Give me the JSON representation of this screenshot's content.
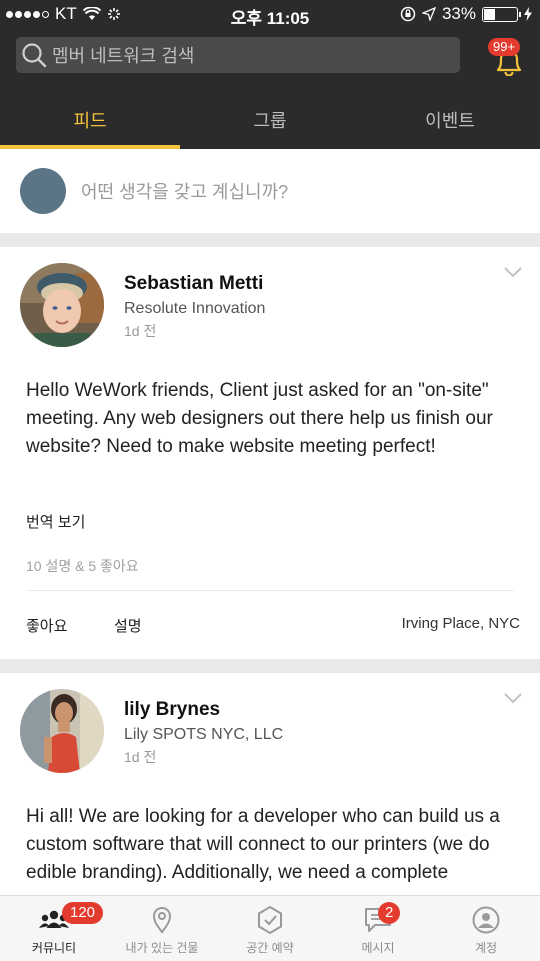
{
  "status": {
    "carrier": "KT",
    "time": "오후 11:05",
    "battery": "33%"
  },
  "header": {
    "search_placeholder": "멤버 네트워크 검색",
    "notif_badge": "99+",
    "tabs": [
      {
        "label": "피드",
        "active": true
      },
      {
        "label": "그룹",
        "active": false
      },
      {
        "label": "이벤트",
        "active": false
      }
    ]
  },
  "composer": {
    "placeholder": "어떤 생각을 갖고 계십니까?"
  },
  "posts": [
    {
      "name": "Sebastian Metti",
      "company": "Resolute Innovation",
      "time": "1d 전",
      "text": "Hello WeWork friends, Client just asked for an \"on-site\" meeting. Any web designers out there help us finish our website? Need to make website meeting perfect!",
      "translate": "번역 보기",
      "stats": "10 설명 & 5 좋아요",
      "like": "좋아요",
      "comment": "설명",
      "location": "Irving Place, NYC"
    },
    {
      "name": "lily Brynes",
      "company": "Lily SPOTS NYC, LLC",
      "time": "1d 전",
      "text": "Hi all! We are looking for a developer who can build us a custom software that will connect to our printers (we do edible branding). Additionally, we need a complete"
    }
  ],
  "bottom_nav": [
    {
      "label": "커뮤니티",
      "badge": "120",
      "active": true
    },
    {
      "label": "내가 있는 건물",
      "active": false
    },
    {
      "label": "공간 예약",
      "active": false
    },
    {
      "label": "메시지",
      "badge": "2",
      "active": false
    },
    {
      "label": "계정",
      "active": false
    }
  ],
  "colors": {
    "accent": "#f3c33a",
    "header_bg": "#2b2b2b",
    "badge": "#e43b2f"
  }
}
